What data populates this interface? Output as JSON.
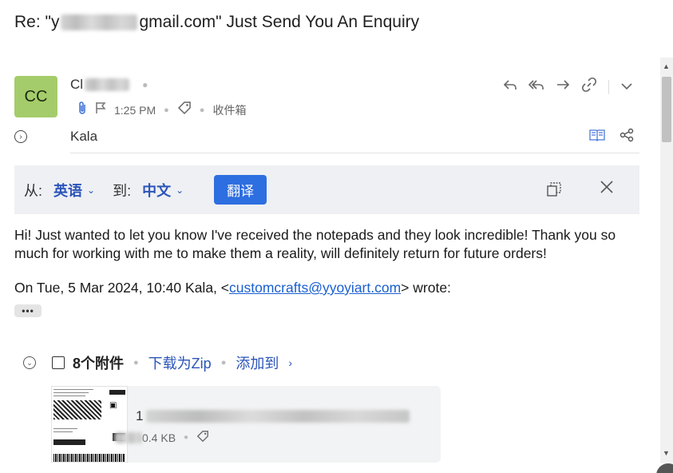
{
  "subject": {
    "prefix": "Re: \"y",
    "suffix": "gmail.com\" Just Send You An Enquiry"
  },
  "header": {
    "avatar_initials": "CC",
    "sender_prefix": "Cl",
    "time": "1:25 PM",
    "folder": "收件箱",
    "recipient": "Kala",
    "icons": [
      "paperclip-icon",
      "flag-icon",
      "tag-icon",
      "reply-icon",
      "reply-all-icon",
      "forward-icon",
      "link-icon",
      "more-chevron-icon",
      "reader-icon",
      "share-icon",
      "expand-icon"
    ]
  },
  "translate": {
    "from_label": "从:",
    "from_lang": "英语",
    "to_label": "到:",
    "to_lang": "中文",
    "button": "翻译"
  },
  "message": {
    "body": "Hi! Just wanted to let you know I've received the notepads and they look incredible! Thank you so much for working with me to make them a reality, will definitely return for future orders!",
    "quote_prefix": "On Tue, 5 Mar 2024, 10:40 Kala, <",
    "quote_email": "customcrafts@yyoyiart.com",
    "quote_suffix": "> wrote:",
    "more": "•••"
  },
  "attachments": {
    "count_label": "8个附件",
    "download_zip": "下载为Zip",
    "add_to": "添加到",
    "item": {
      "name_prefix": "1",
      "size_suffix": "0.4 KB"
    }
  },
  "colors": {
    "avatar_bg": "#a5cc6a",
    "accent": "#2c55b9",
    "translate_button": "#2d6ee0",
    "translate_bar_bg": "#eef0f3",
    "link": "#1a5fd0"
  }
}
